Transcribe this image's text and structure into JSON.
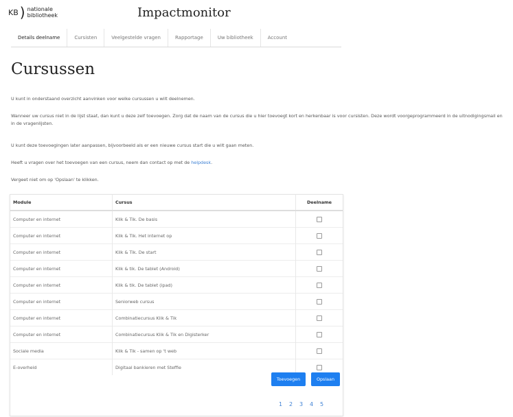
{
  "header": {
    "logo_mark": "KB",
    "logo_line1": "nationale",
    "logo_line2": "bibliotheek",
    "app_title": "Impactmonitor"
  },
  "tabs": [
    {
      "label": "Details deelname",
      "active": true
    },
    {
      "label": "Cursisten",
      "active": false
    },
    {
      "label": "Veelgestelde vragen",
      "active": false
    },
    {
      "label": "Rapportage",
      "active": false
    },
    {
      "label": "Uw bibliotheek",
      "active": false
    },
    {
      "label": "Account",
      "active": false
    }
  ],
  "page": {
    "title": "Cursussen",
    "intro": "U kunt in onderstaand overzicht aanvinken voor welke cursussen u wilt deelnemen.",
    "p2": "Wanneer uw cursus niet in de lijst staat, dan kunt u deze zelf toevoegen. Zorg dat de naam van de cursus die u hier toevoegt kort en herkenbaar is voor cursisten. Deze wordt voorgeprogrammeerd in de uitnodigingsmail en in de vragenlijsten.",
    "p3": "U kunt deze toevoegingen later aanpassen, bijvoorbeeld als er een nieuwe cursus start die u wilt gaan meten.",
    "p4_prefix": "Heeft u vragen over het toevoegen van een cursus, neem dan contact op met de ",
    "p4_link": "helpdesk",
    "p4_suffix": ".",
    "p5": "Vergeet niet om op 'Opslaan' te klikken."
  },
  "table": {
    "headers": {
      "module": "Module",
      "course": "Cursus",
      "participation": "Deelname"
    },
    "rows": [
      {
        "module": "Computer en internet",
        "course": "Klik & Tik. De basis",
        "checked": false
      },
      {
        "module": "Computer en internet",
        "course": "Klik & Tik. Het internet op",
        "checked": false
      },
      {
        "module": "Computer en internet",
        "course": "Klik & Tik. De start",
        "checked": false
      },
      {
        "module": "Computer en internet",
        "course": "Klik & tik. De tablet (Android)",
        "checked": false
      },
      {
        "module": "Computer en internet",
        "course": "Klik & tik. De tablet (ipad)",
        "checked": false
      },
      {
        "module": "Computer en internet",
        "course": "Seniorweb cursus",
        "checked": false
      },
      {
        "module": "Computer en internet",
        "course": "Combinatiecursus Klik & Tik",
        "checked": false
      },
      {
        "module": "Computer en internet",
        "course": "Combinatiecursus Klik & Tik en Digisterker",
        "checked": false
      },
      {
        "module": "Sociale media",
        "course": "Klik & Tik - samen op 't web",
        "checked": false
      },
      {
        "module": "E-overheid",
        "course": "Digitaal bankieren met Steffie",
        "checked": false
      }
    ],
    "add_button": "Toevoegen",
    "save_button": "Opslaan",
    "pages": [
      "1",
      "2",
      "3",
      "4",
      "5"
    ]
  },
  "colors": {
    "accent": "#1e7ff0",
    "link": "#3d80d4"
  }
}
